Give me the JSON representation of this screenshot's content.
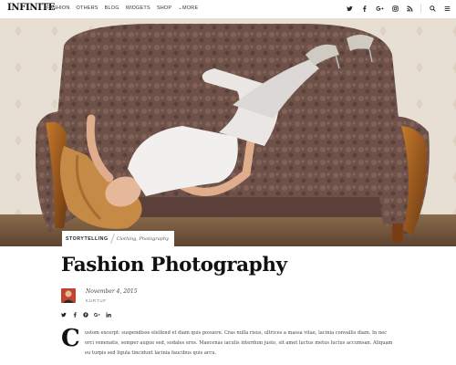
{
  "site": {
    "logo": "INFINITE"
  },
  "nav": {
    "items": [
      "FASHION",
      "OTHERS",
      "BLOG",
      "WIDGETS",
      "SHOP",
      "MORE"
    ]
  },
  "social": {
    "icons": [
      "twitter-icon",
      "facebook-icon",
      "google-plus-icon",
      "instagram-icon",
      "rss-icon",
      "search-icon",
      "menu-icon"
    ]
  },
  "post": {
    "category": "STORYTELLING",
    "subcategories": "Clothing, Photography",
    "title": "Fashion Photography",
    "date": "November 4, 2015",
    "author": "KURTUF",
    "dropcap": "C",
    "excerpt": "ustom excerpt: suspendisse eleifend et diam quis posuere. Cras nulla risus, ultrices a massa vitae, lacinia convallis diam. In nec orci venenatis, semper augue sed, sodales eros. Maecenas iaculis interdum justo, sit amet luctus metus luctus accumsan. Aliquam eu turpis sed ligula tincidunt lacinia faucibus quis arcu."
  },
  "share": {
    "icons": [
      "twitter-icon",
      "facebook-icon",
      "pinterest-icon",
      "google-plus-icon",
      "linkedin-icon"
    ]
  },
  "colors": {
    "text": "#111111",
    "muted": "#777777",
    "sofa": "#6b4e46",
    "wood": "#9b5a1f",
    "wall": "#e6ddd0"
  }
}
